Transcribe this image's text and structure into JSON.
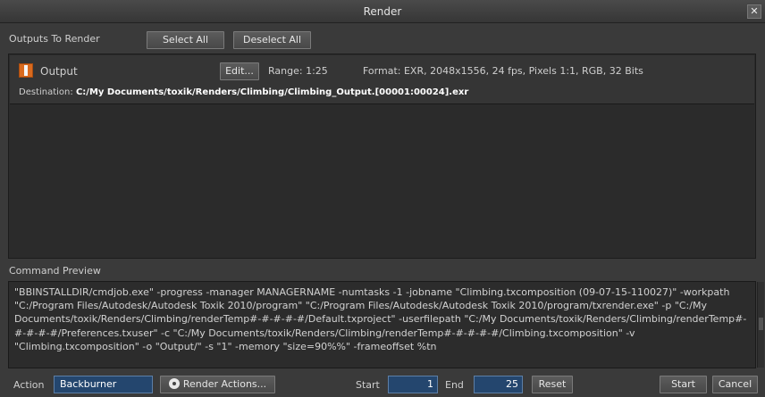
{
  "window": {
    "title": "Render",
    "close_glyph": "✕"
  },
  "outputs": {
    "heading": "Outputs To Render",
    "select_all": "Select All",
    "deselect_all": "Deselect All",
    "item": {
      "name": "Output",
      "checked": true,
      "edit_label": "Edit...",
      "range": "Range:  1:25",
      "format": "Format:  EXR, 2048x1556, 24 fps, Pixels 1:1, RGB, 32 Bits",
      "destination_label": "Destination:",
      "destination_path": "C:/My Documents/toxik/Renders/Climbing/Climbing_Output.[00001:00024].exr"
    }
  },
  "command_preview": {
    "heading": "Command Preview",
    "text": "\"BBINSTALLDIR/cmdjob.exe\" -progress -manager MANAGERNAME -numtasks -1 -jobname \"Climbing.txcomposition (09-07-15-110027)\" -workpath \"C:/Program Files/Autodesk/Autodesk Toxik 2010/program\" \"C:/Program Files/Autodesk/Autodesk Toxik 2010/program/txrender.exe\" -p \"C:/My Documents/toxik/Renders/Climbing/renderTemp#-#-#-#-#/Default.txproject\" -userfilepath \"C:/My Documents/toxik/Renders/Climbing/renderTemp#-#-#-#-#/Preferences.txuser\" -c \"C:/My Documents/toxik/Renders/Climbing/renderTemp#-#-#-#-#/Climbing.txcomposition\" -v \"Climbing.txcomposition\" -o \"Output/\" -s \"1\" -memory \"size=90%%\" -frameoffset %tn"
  },
  "footer": {
    "action_label": "Action",
    "action_value": "Backburner",
    "render_actions": "Render Actions...",
    "start_label": "Start",
    "start_value": "1",
    "end_label": "End",
    "end_value": "25",
    "reset": "Reset",
    "start_button": "Start",
    "cancel_button": "Cancel"
  },
  "colors": {
    "accent": "#d96a1e",
    "field": "#24466e"
  }
}
